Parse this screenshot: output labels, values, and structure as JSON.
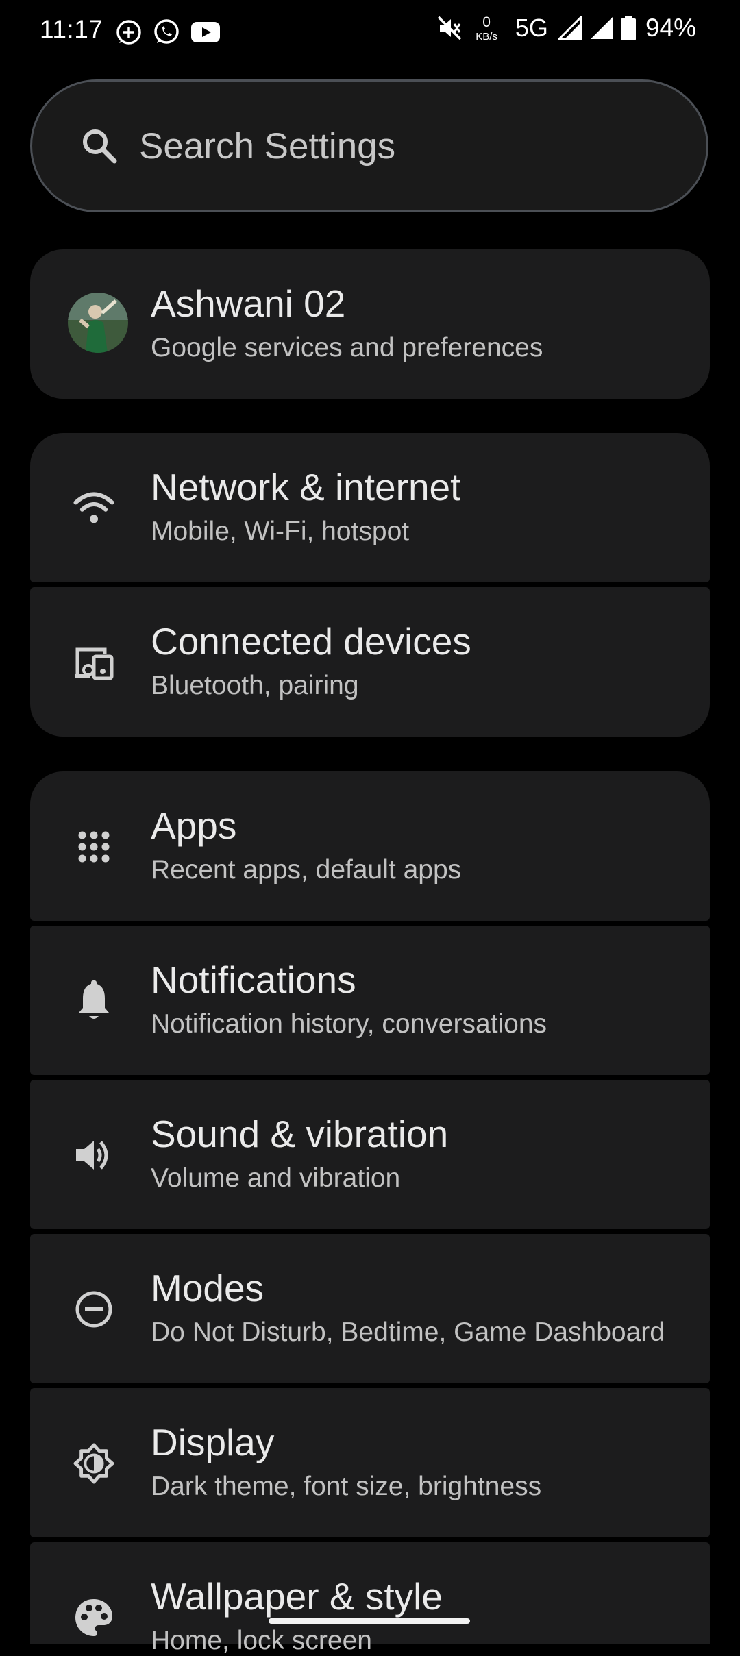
{
  "status_bar": {
    "time": "11:17",
    "data_rate_value": "0",
    "data_rate_unit": "KB/s",
    "network": "5G",
    "battery_pct": "94%",
    "icons": [
      "add-circle-icon",
      "whatsapp-icon",
      "youtube-icon",
      "mute-icon",
      "signal-icon",
      "signal-icon",
      "battery-icon"
    ]
  },
  "search": {
    "placeholder": "Search Settings",
    "icon": "search-icon"
  },
  "account": {
    "name": "Ashwani 02",
    "subtitle": "Google services and preferences"
  },
  "items": [
    {
      "title": "Network & internet",
      "subtitle": "Mobile, Wi-Fi, hotspot",
      "icon": "wifi-icon"
    },
    {
      "title": "Connected devices",
      "subtitle": "Bluetooth, pairing",
      "icon": "devices-icon"
    },
    {
      "title": "Apps",
      "subtitle": "Recent apps, default apps",
      "icon": "apps-grid-icon"
    },
    {
      "title": "Notifications",
      "subtitle": "Notification history, conversations",
      "icon": "bell-icon"
    },
    {
      "title": "Sound & vibration",
      "subtitle": "Volume and vibration",
      "icon": "speaker-icon"
    },
    {
      "title": "Modes",
      "subtitle": "Do Not Disturb, Bedtime, Game Dashboard",
      "icon": "minus-circle-icon"
    },
    {
      "title": "Display",
      "subtitle": "Dark theme, font size, brightness",
      "icon": "brightness-icon"
    },
    {
      "title": "Wallpaper & style",
      "subtitle": "Home, lock screen",
      "icon": "palette-icon"
    }
  ],
  "colors": {
    "background": "#000000",
    "card": "#1c1c1d",
    "title_text": "#eaeaea",
    "subtitle_text": "#c2c2c2",
    "search_border": "#4b4f55"
  }
}
